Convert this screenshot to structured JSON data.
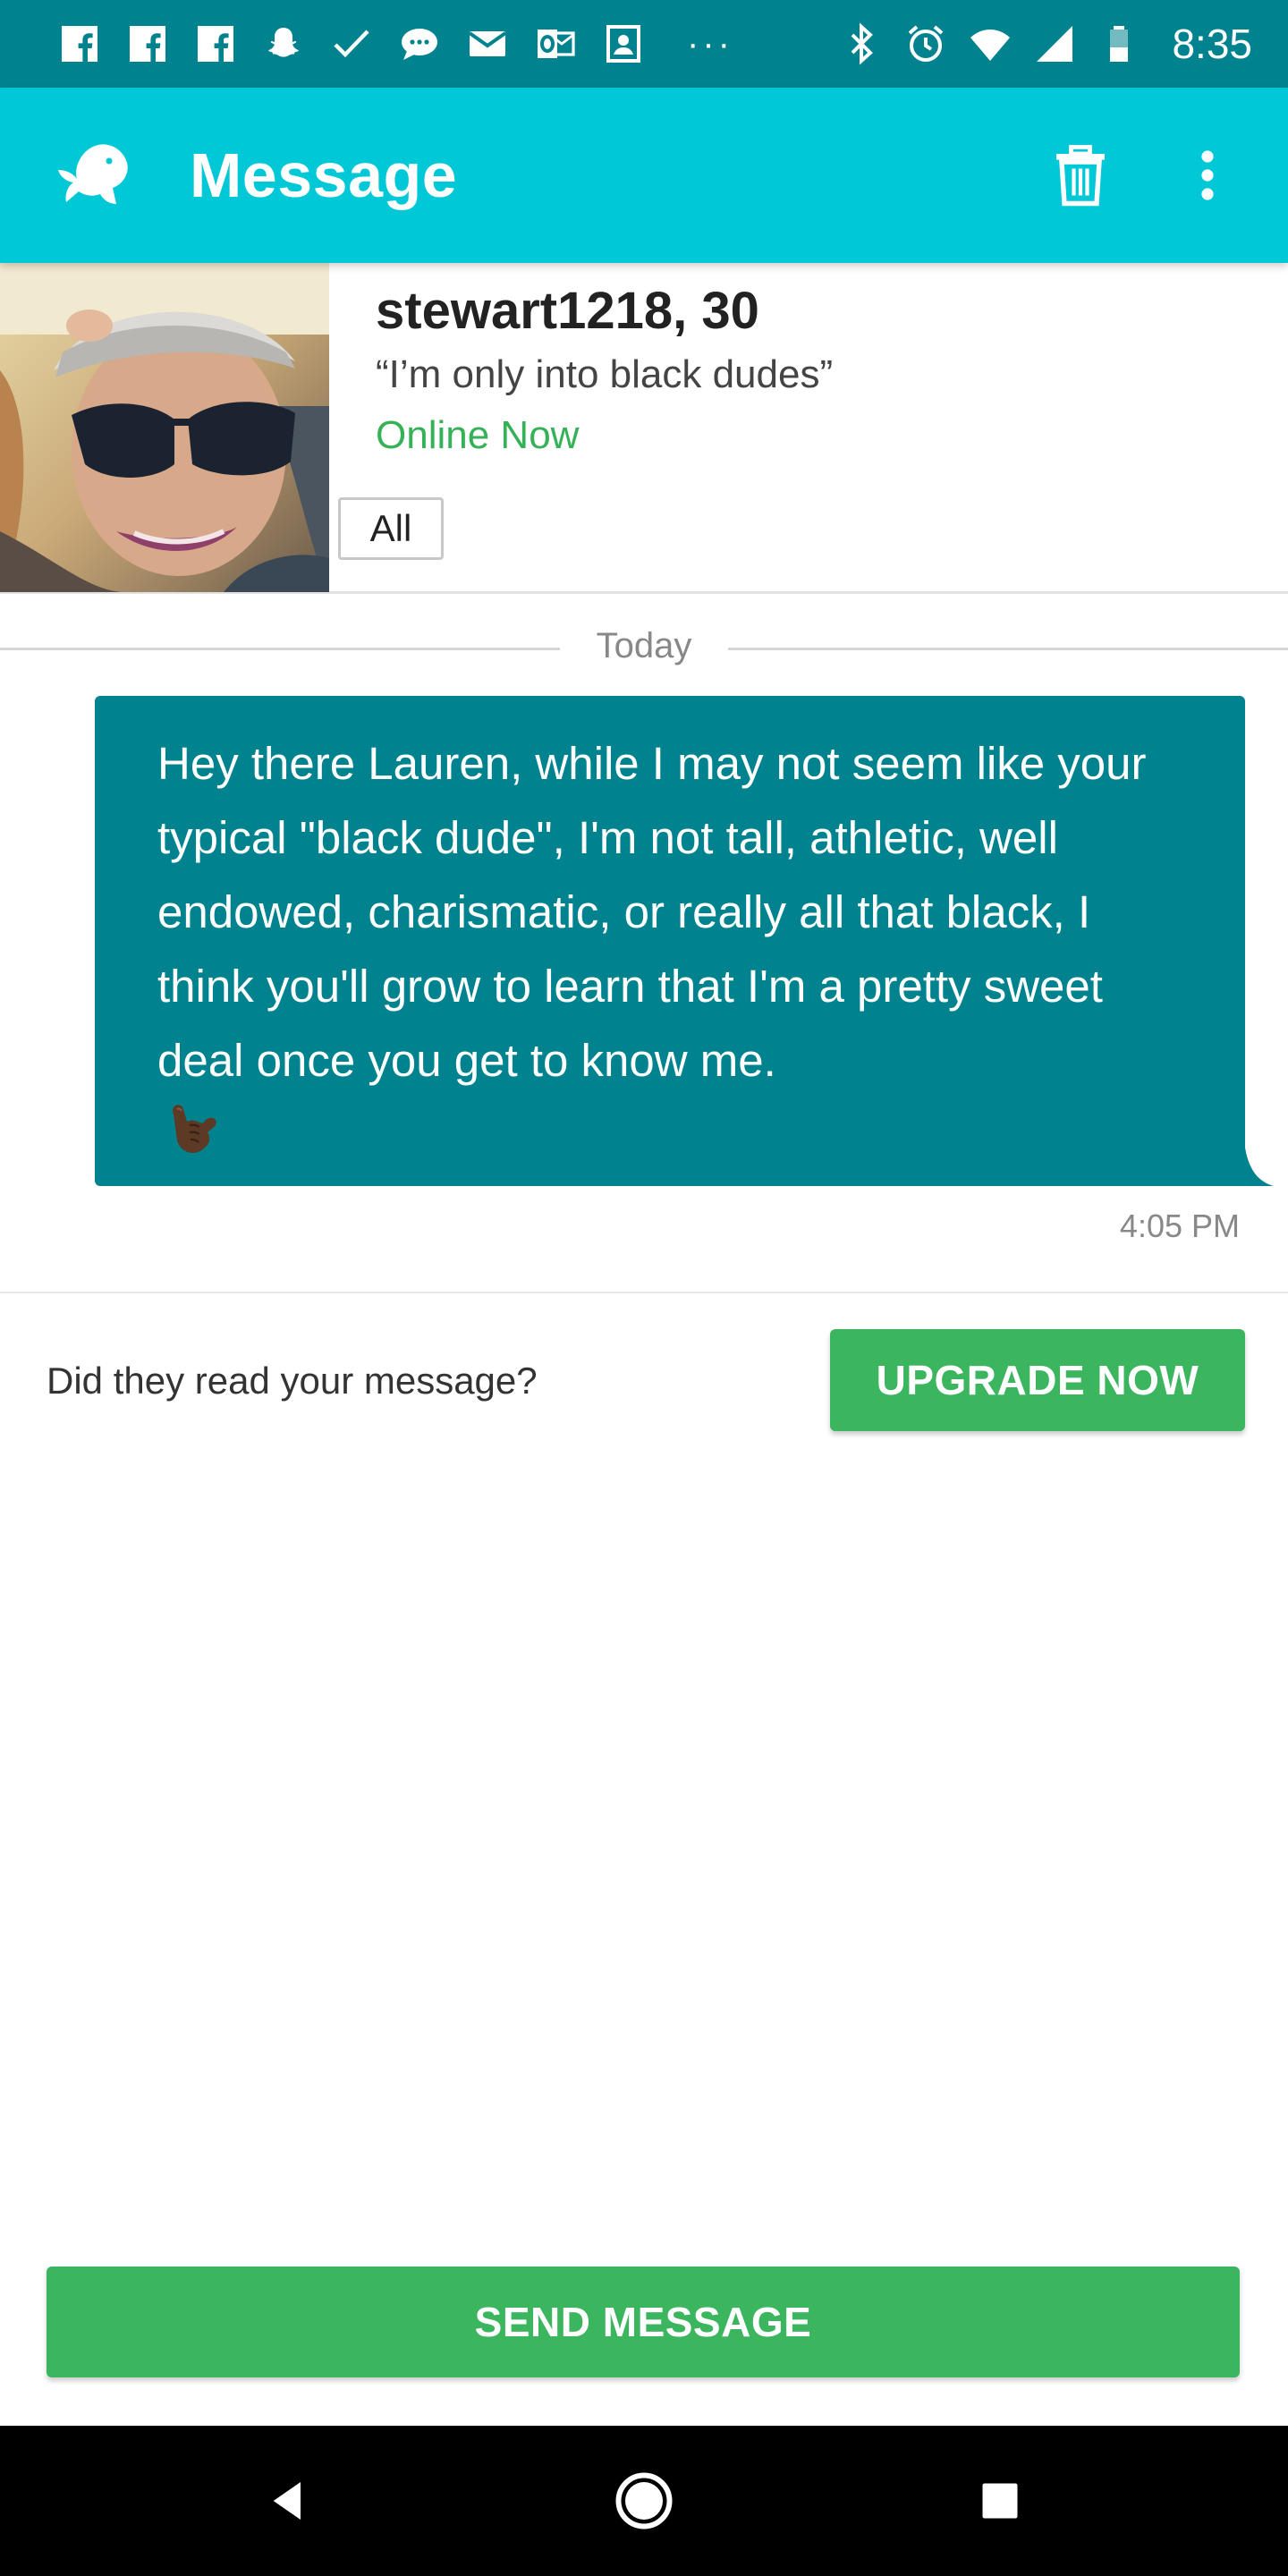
{
  "status_bar": {
    "time": "8:35",
    "overflow": "···",
    "icons": [
      "facebook-icon",
      "facebook-icon",
      "facebook-icon",
      "snapchat-icon",
      "check-icon",
      "chat-bubble-icon",
      "mail-icon",
      "outlook-icon",
      "contact-card-icon",
      "bluetooth-icon",
      "alarm-icon",
      "wifi-icon",
      "signal-icon",
      "battery-icon"
    ]
  },
  "app_bar": {
    "title": "Message",
    "logo_icon": "fish-logo-icon",
    "actions": [
      "trash-icon",
      "more-vert-icon"
    ]
  },
  "profile": {
    "name": "stewart1218, 30",
    "headline": "“I’m only into black dudes”",
    "status": "Online Now",
    "filter": "All"
  },
  "conversation": {
    "date_label": "Today",
    "messages": [
      {
        "text": "Hey there Lauren, while I may not seem like your typical \"black dude\", I'm not tall, athletic, well endowed, charismatic, or really all that black, I think you'll grow to learn that I'm a pretty sweet deal once you get to know me.",
        "emoji": "call-me-hand-icon",
        "time": "4:05 PM"
      }
    ]
  },
  "read_receipt": {
    "prompt": "Did they read your message?",
    "button": "UPGRADE NOW"
  },
  "composer": {
    "send_button": "SEND MESSAGE"
  },
  "nav_bar": {
    "buttons": [
      "back-icon",
      "home-icon",
      "recent-apps-icon"
    ]
  },
  "colors": {
    "status_bar": "#00838f",
    "app_bar": "#00c8d7",
    "bubble": "#00838f",
    "accent_green": "#3bb55e",
    "online_green": "#35b257"
  }
}
